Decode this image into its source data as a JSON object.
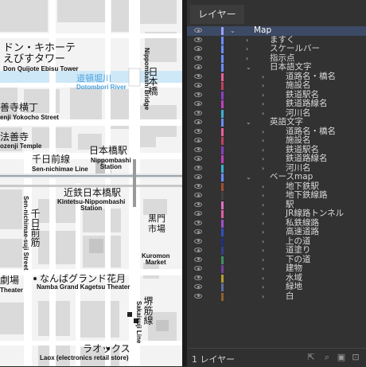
{
  "map": {
    "labels": {
      "don_quijote_jp": "ドン・キホーテ",
      "ebisu_tower_jp": "えびすタワー",
      "don_quijote_en": "Don Quijote Ebisu Tower",
      "dotombori_jp": "道頓堀川",
      "dotombori_en": "Dotombori River",
      "nippombashi_bridge_jp": "日本橋",
      "nippombashi_bridge_en": "Nippombashi Bridge",
      "hozenji_yokocho_jp": "善寺横丁",
      "hozenji_yokocho_en": "enji Yokocho Street",
      "hozenji_temple_jp": "法善寺",
      "hozenji_temple_en": "ozenji Temple",
      "sennichimae_line_jp": "千日前線",
      "sennichimae_line_en": "Sen-nichimae Line",
      "nippombashi_station_jp": "日本橋駅",
      "nippombashi_station_en": "Nippombashi\nStation",
      "kintetsu_jp": "近鉄日本橋駅",
      "kintetsu_en": "Kintetsu-Nippombashi\nStation",
      "sennichimae_suji_jp": "千日前筋",
      "sennichimae_suji_en": "Sen-nichimae-suji Street",
      "kuromon_jp": "黒門市場",
      "kuromon_en": "Kuromon\nMarket",
      "theater_jp": "劇場",
      "theater_en": "Theater",
      "namba_kagetsu_jp": "なんばグランド花月",
      "namba_kagetsu_en": "Namba Grand Kagetsu Theater",
      "sakaisuji_jp": "堺筋線",
      "sakaisuji_en": "Sakaisuji Line",
      "laox_jp": "ラオックス",
      "laox_en": "Laox (electronics retail store)"
    }
  },
  "panel": {
    "tab_label": "レイヤー",
    "layers": [
      {
        "name": "Map",
        "level": 0,
        "expanded": true,
        "color": "#9aa3ff",
        "selected": true
      },
      {
        "name": "ますく",
        "level": 1,
        "expanded": false,
        "color": "#6b8cff"
      },
      {
        "name": "スケールバー",
        "level": 1,
        "expanded": false,
        "color": "#6b8cff"
      },
      {
        "name": "指示点",
        "level": 1,
        "expanded": false,
        "color": "#6b8cff"
      },
      {
        "name": "日本語文字",
        "level": 1,
        "expanded": true,
        "color": "#6b8cff"
      },
      {
        "name": "道路名・橋名",
        "level": 2,
        "expanded": false,
        "color": "#e8609a"
      },
      {
        "name": "施設名",
        "level": 2,
        "expanded": false,
        "color": "#c04060"
      },
      {
        "name": "鉄道駅名",
        "level": 2,
        "expanded": false,
        "color": "#8a3fc0"
      },
      {
        "name": "鉄道路線名",
        "level": 2,
        "expanded": false,
        "color": "#c040c0"
      },
      {
        "name": "河川名",
        "level": 2,
        "expanded": false,
        "color": "#3fb0d0"
      },
      {
        "name": "英語文字",
        "level": 1,
        "expanded": true,
        "color": "#6b8cff"
      },
      {
        "name": "道路名・橋名",
        "level": 2,
        "expanded": false,
        "color": "#e8609a"
      },
      {
        "name": "施設名",
        "level": 2,
        "expanded": false,
        "color": "#c04060"
      },
      {
        "name": "鉄道駅名",
        "level": 2,
        "expanded": false,
        "color": "#8a3fc0"
      },
      {
        "name": "鉄道路線名",
        "level": 2,
        "expanded": false,
        "color": "#c040c0"
      },
      {
        "name": "河川名",
        "level": 2,
        "expanded": false,
        "color": "#3fb0d0"
      },
      {
        "name": "ベースmap",
        "level": 1,
        "expanded": true,
        "color": "#6b8cff"
      },
      {
        "name": "地下鉄駅",
        "level": 2,
        "expanded": false,
        "color": "#a05030"
      },
      {
        "name": "地下鉄線路",
        "level": 2,
        "expanded": false,
        "color": "#404040"
      },
      {
        "name": "駅",
        "level": 2,
        "expanded": false,
        "color": "#e070c0"
      },
      {
        "name": "JR線路トンネル",
        "level": 2,
        "expanded": false,
        "color": "#e060a0"
      },
      {
        "name": "私鉄線路",
        "level": 2,
        "expanded": false,
        "color": "#a050d0"
      },
      {
        "name": "高速道路",
        "level": 2,
        "expanded": false,
        "color": "#3050c0"
      },
      {
        "name": "上の道",
        "level": 2,
        "expanded": false,
        "color": "#203080"
      },
      {
        "name": "道塗り",
        "level": 2,
        "expanded": false,
        "color": "#304090"
      },
      {
        "name": "下の道",
        "level": 2,
        "expanded": false,
        "color": "#3f8f5f"
      },
      {
        "name": "建物",
        "level": 2,
        "expanded": false,
        "color": "#7a3fa0"
      },
      {
        "name": "水域",
        "level": 2,
        "expanded": false,
        "color": "#b0a030"
      },
      {
        "name": "緑地",
        "level": 2,
        "expanded": false,
        "color": "#5f6fa0"
      },
      {
        "name": "白",
        "level": 2,
        "expanded": false,
        "color": "#906030"
      }
    ],
    "footer": {
      "count_label": "1 レイヤー"
    }
  }
}
